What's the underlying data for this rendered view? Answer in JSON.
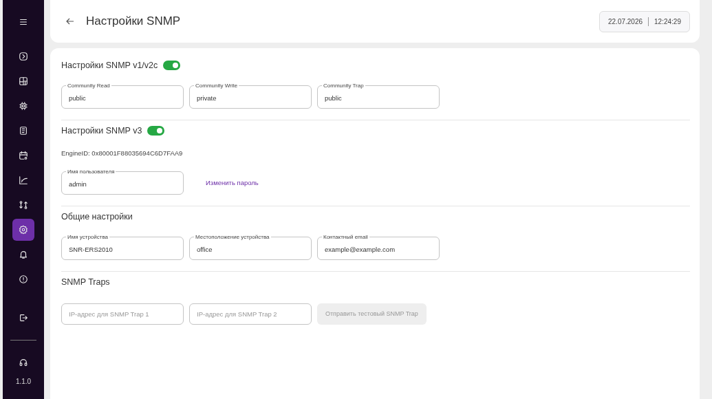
{
  "sidebar": {
    "items": [
      {
        "selected": false
      },
      {
        "selected": false
      },
      {
        "selected": false
      },
      {
        "selected": false
      },
      {
        "selected": false
      },
      {
        "selected": false
      },
      {
        "selected": false
      },
      {
        "selected": true
      },
      {
        "selected": false
      },
      {
        "selected": false
      }
    ],
    "version": "1.1.0"
  },
  "header": {
    "title": "Настройки SNMP",
    "date": "22.07.2026",
    "time": "12:24:29"
  },
  "sections": [
    {
      "title": "Настройки SNMP v1/v2c",
      "toggle": {
        "on": true
      },
      "fields": [
        {
          "label": "Community Read",
          "value": "public"
        },
        {
          "label": "Community Write",
          "value": "private"
        },
        {
          "label": "Community Trap",
          "value": "public"
        }
      ]
    },
    {
      "title": "Настройки SNMP v3",
      "toggle": {
        "on": true
      },
      "engine_id": "EngineID: 0x80001F88035694C6D7FAA9",
      "fields": [
        {
          "label": "Имя пользователя",
          "value": "admin"
        }
      ],
      "link": "Изменить пароль"
    },
    {
      "title": "Общие настройки",
      "fields": [
        {
          "label": "Имя устройства",
          "value": "SNR-ERS2010"
        },
        {
          "label": "Местоположение устройства",
          "value": "office"
        },
        {
          "label": "Контактный email",
          "value": "example@example.com"
        }
      ]
    },
    {
      "title": "SNMP Traps",
      "fields": [
        {
          "placeholder": "IP-адрес для SNMP Trap 1"
        },
        {
          "placeholder": "IP-адрес для SNMP Trap 2"
        }
      ],
      "button": {
        "label": "Отправить тестовый SNMP Trap",
        "disabled": true
      }
    }
  ]
}
